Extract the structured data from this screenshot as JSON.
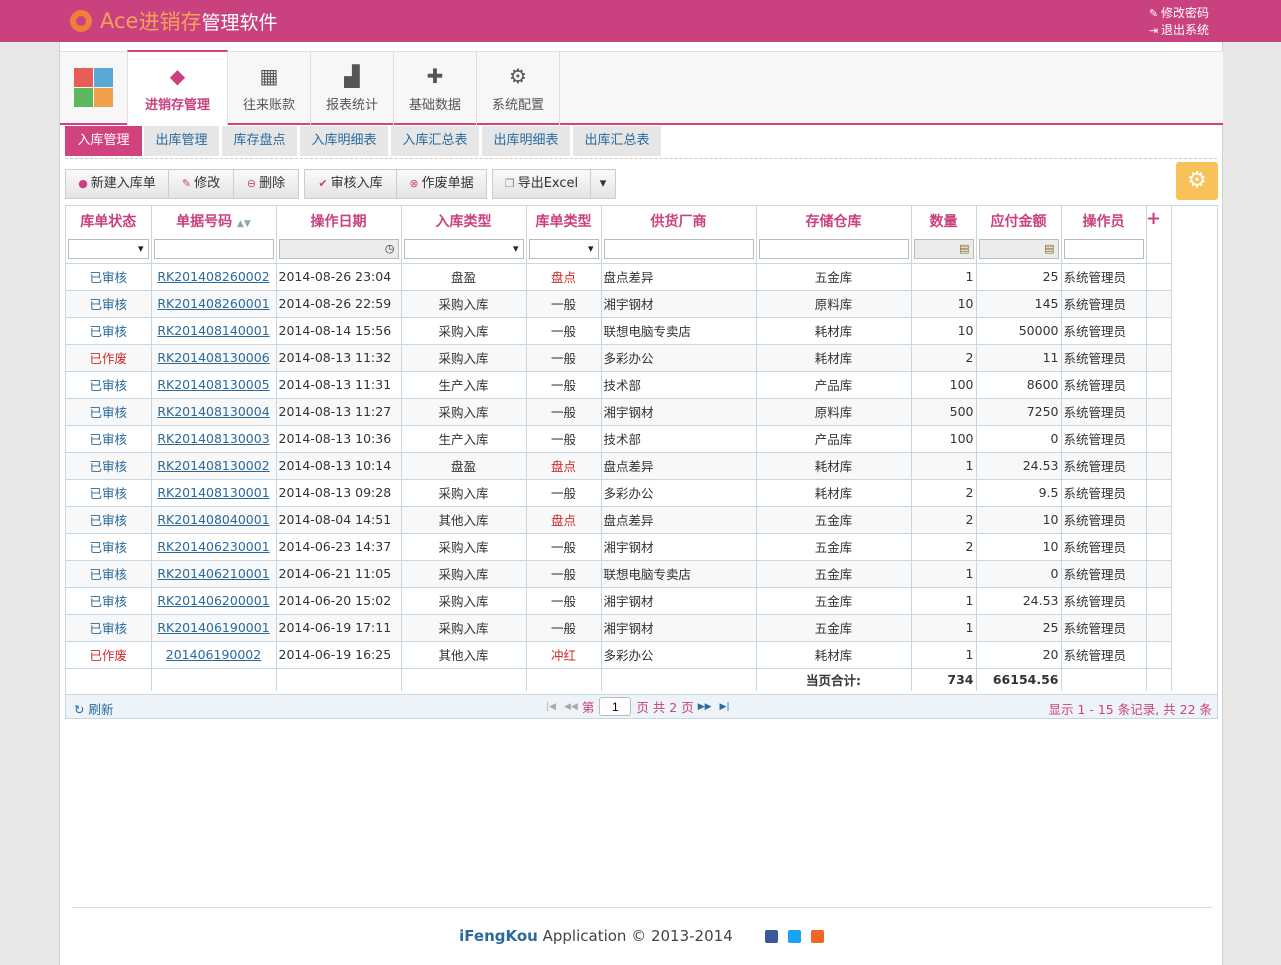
{
  "brand": {
    "ace": "Ace",
    "highlight": "进销存",
    "rest": "管理软件"
  },
  "top_links": {
    "change_password": "修改密码",
    "logout": "退出系统"
  },
  "nav_tabs": [
    {
      "label": "进销存管理",
      "icon": "cube-icon"
    },
    {
      "label": "往来账款",
      "icon": "ledger-icon"
    },
    {
      "label": "报表统计",
      "icon": "bar-chart-icon"
    },
    {
      "label": "基础数据",
      "icon": "puzzle-icon"
    },
    {
      "label": "系统配置",
      "icon": "gear-icon"
    }
  ],
  "sub_tabs": [
    "入库管理",
    "出库管理",
    "库存盘点",
    "入库明细表",
    "入库汇总表",
    "出库明细表",
    "出库汇总表"
  ],
  "toolbar": {
    "new": "新建入库单",
    "edit": "修改",
    "delete": "删除",
    "audit": "审核入库",
    "void": "作废单据",
    "export": "导出Excel"
  },
  "columns": [
    "库单状态",
    "单据号码",
    "操作日期",
    "入库类型",
    "库单类型",
    "供货厂商",
    "存储仓库",
    "数量",
    "应付金额",
    "操作员"
  ],
  "rows": [
    {
      "status": "已审核",
      "no": "RK201408260002",
      "date": "2014-08-26 23:04",
      "in_type": "盘盈",
      "bill_type": "盘点",
      "supplier": "盘点差异",
      "warehouse": "五金库",
      "qty": "1",
      "amount": "25",
      "operator": "系统管理员"
    },
    {
      "status": "已审核",
      "no": "RK201408260001",
      "date": "2014-08-26 22:59",
      "in_type": "采购入库",
      "bill_type": "一般",
      "supplier": "湘宇钢材",
      "warehouse": "原料库",
      "qty": "10",
      "amount": "145",
      "operator": "系统管理员"
    },
    {
      "status": "已审核",
      "no": "RK201408140001",
      "date": "2014-08-14 15:56",
      "in_type": "采购入库",
      "bill_type": "一般",
      "supplier": "联想电脑专卖店",
      "warehouse": "耗材库",
      "qty": "10",
      "amount": "50000",
      "operator": "系统管理员"
    },
    {
      "status": "已作废",
      "no": "RK201408130006",
      "date": "2014-08-13 11:32",
      "in_type": "采购入库",
      "bill_type": "一般",
      "supplier": "多彩办公",
      "warehouse": "耗材库",
      "qty": "2",
      "amount": "11",
      "operator": "系统管理员"
    },
    {
      "status": "已审核",
      "no": "RK201408130005",
      "date": "2014-08-13 11:31",
      "in_type": "生产入库",
      "bill_type": "一般",
      "supplier": "技术部",
      "warehouse": "产品库",
      "qty": "100",
      "amount": "8600",
      "operator": "系统管理员"
    },
    {
      "status": "已审核",
      "no": "RK201408130004",
      "date": "2014-08-13 11:27",
      "in_type": "采购入库",
      "bill_type": "一般",
      "supplier": "湘宇钢材",
      "warehouse": "原料库",
      "qty": "500",
      "amount": "7250",
      "operator": "系统管理员"
    },
    {
      "status": "已审核",
      "no": "RK201408130003",
      "date": "2014-08-13 10:36",
      "in_type": "生产入库",
      "bill_type": "一般",
      "supplier": "技术部",
      "warehouse": "产品库",
      "qty": "100",
      "amount": "0",
      "operator": "系统管理员"
    },
    {
      "status": "已审核",
      "no": "RK201408130002",
      "date": "2014-08-13 10:14",
      "in_type": "盘盈",
      "bill_type": "盘点",
      "supplier": "盘点差异",
      "warehouse": "耗材库",
      "qty": "1",
      "amount": "24.53",
      "operator": "系统管理员"
    },
    {
      "status": "已审核",
      "no": "RK201408130001",
      "date": "2014-08-13 09:28",
      "in_type": "采购入库",
      "bill_type": "一般",
      "supplier": "多彩办公",
      "warehouse": "耗材库",
      "qty": "2",
      "amount": "9.5",
      "operator": "系统管理员"
    },
    {
      "status": "已审核",
      "no": "RK201408040001",
      "date": "2014-08-04 14:51",
      "in_type": "其他入库",
      "bill_type": "盘点",
      "supplier": "盘点差异",
      "warehouse": "五金库",
      "qty": "2",
      "amount": "10",
      "operator": "系统管理员"
    },
    {
      "status": "已审核",
      "no": "RK201406230001",
      "date": "2014-06-23 14:37",
      "in_type": "采购入库",
      "bill_type": "一般",
      "supplier": "湘宇钢材",
      "warehouse": "五金库",
      "qty": "2",
      "amount": "10",
      "operator": "系统管理员"
    },
    {
      "status": "已审核",
      "no": "RK201406210001",
      "date": "2014-06-21 11:05",
      "in_type": "采购入库",
      "bill_type": "一般",
      "supplier": "联想电脑专卖店",
      "warehouse": "五金库",
      "qty": "1",
      "amount": "0",
      "operator": "系统管理员"
    },
    {
      "status": "已审核",
      "no": "RK201406200001",
      "date": "2014-06-20 15:02",
      "in_type": "采购入库",
      "bill_type": "一般",
      "supplier": "湘宇钢材",
      "warehouse": "五金库",
      "qty": "1",
      "amount": "24.53",
      "operator": "系统管理员"
    },
    {
      "status": "已审核",
      "no": "RK201406190001",
      "date": "2014-06-19 17:11",
      "in_type": "采购入库",
      "bill_type": "一般",
      "supplier": "湘宇钢材",
      "warehouse": "五金库",
      "qty": "1",
      "amount": "25",
      "operator": "系统管理员"
    },
    {
      "status": "已作废",
      "no": "201406190002",
      "date": "2014-06-19 16:25",
      "in_type": "其他入库",
      "bill_type": "冲红",
      "supplier": "多彩办公",
      "warehouse": "耗材库",
      "qty": "1",
      "amount": "20",
      "operator": "系统管理员"
    }
  ],
  "summary": {
    "label": "当页合计:",
    "qty": "734",
    "amount": "66154.56"
  },
  "pager": {
    "refresh": "刷新",
    "page_prefix": "第",
    "current_page": "1",
    "page_suffix": "页 共 2 页",
    "info": "显示 1 - 15 条记录, 共 22 条"
  },
  "footer": {
    "brand": "iFengKou",
    "text": "Application © 2013-2014"
  },
  "colors": {
    "topbar": "#c9427f",
    "accent": "#d1437f",
    "link": "#2a6a9e",
    "void_red": "#d12a2a",
    "settings": "#f8c15a"
  }
}
